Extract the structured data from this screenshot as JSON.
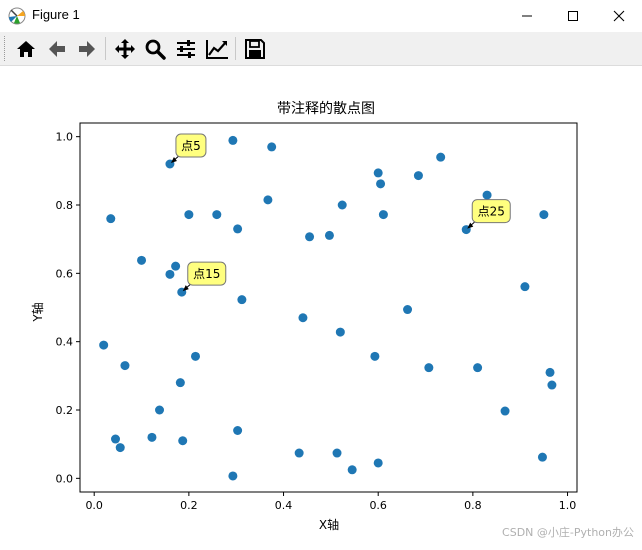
{
  "window": {
    "title": "Figure 1",
    "icons": {
      "app": "matplotlib-icon",
      "minimize": "minimize-icon",
      "maximize": "maximize-icon",
      "close": "close-icon"
    }
  },
  "toolbar": {
    "buttons": [
      {
        "name": "home",
        "icon": "home-icon"
      },
      {
        "name": "back",
        "icon": "back-arrow-icon"
      },
      {
        "name": "forward",
        "icon": "forward-arrow-icon"
      },
      {
        "name": "pan",
        "icon": "pan-move-icon"
      },
      {
        "name": "zoom",
        "icon": "zoom-magnifier-icon"
      },
      {
        "name": "subplots",
        "icon": "configure-subplots-icon"
      },
      {
        "name": "edit-axis",
        "icon": "edit-axis-curve-icon"
      },
      {
        "name": "save",
        "icon": "save-floppy-icon"
      }
    ]
  },
  "watermark": "CSDN @小庄-Python办公",
  "chart_data": {
    "type": "scatter",
    "title": "带注释的散点图",
    "xlabel": "X轴",
    "ylabel": "Y轴",
    "xlim": [
      -0.03,
      1.02
    ],
    "ylim": [
      -0.04,
      1.04
    ],
    "xticks": [
      "0.0",
      "0.2",
      "0.4",
      "0.6",
      "0.8",
      "1.0"
    ],
    "yticks": [
      "0.0",
      "0.2",
      "0.4",
      "0.6",
      "0.8",
      "1.0"
    ],
    "marker_color": "#1f77b4",
    "annotation_color": "#ffff7f",
    "points": [
      [
        0.02,
        0.39
      ],
      [
        0.035,
        0.76
      ],
      [
        0.045,
        0.115
      ],
      [
        0.055,
        0.09
      ],
      [
        0.065,
        0.33
      ],
      [
        0.1,
        0.638
      ],
      [
        0.122,
        0.12
      ],
      [
        0.138,
        0.2
      ],
      [
        0.16,
        0.597
      ],
      [
        0.16,
        0.92
      ],
      [
        0.172,
        0.621
      ],
      [
        0.182,
        0.28
      ],
      [
        0.185,
        0.545
      ],
      [
        0.187,
        0.11
      ],
      [
        0.2,
        0.772
      ],
      [
        0.214,
        0.357
      ],
      [
        0.259,
        0.772
      ],
      [
        0.293,
        0.989
      ],
      [
        0.293,
        0.007
      ],
      [
        0.303,
        0.73
      ],
      [
        0.303,
        0.14
      ],
      [
        0.312,
        0.523
      ],
      [
        0.367,
        0.815
      ],
      [
        0.375,
        0.97
      ],
      [
        0.433,
        0.074
      ],
      [
        0.441,
        0.47
      ],
      [
        0.455,
        0.707
      ],
      [
        0.497,
        0.711
      ],
      [
        0.513,
        0.074
      ],
      [
        0.52,
        0.428
      ],
      [
        0.524,
        0.8
      ],
      [
        0.545,
        0.025
      ],
      [
        0.593,
        0.357
      ],
      [
        0.6,
        0.894
      ],
      [
        0.6,
        0.045
      ],
      [
        0.605,
        0.862
      ],
      [
        0.611,
        0.772
      ],
      [
        0.662,
        0.494
      ],
      [
        0.685,
        0.886
      ],
      [
        0.707,
        0.324
      ],
      [
        0.732,
        0.94
      ],
      [
        0.786,
        0.728
      ],
      [
        0.81,
        0.324
      ],
      [
        0.83,
        0.829
      ],
      [
        0.868,
        0.197
      ],
      [
        0.91,
        0.561
      ],
      [
        0.947,
        0.062
      ],
      [
        0.95,
        0.772
      ],
      [
        0.963,
        0.31
      ],
      [
        0.967,
        0.273
      ]
    ],
    "annotations": [
      {
        "text": "点5",
        "x": 0.16,
        "y": 0.92
      },
      {
        "text": "点15",
        "x": 0.185,
        "y": 0.545
      },
      {
        "text": "点25",
        "x": 0.786,
        "y": 0.728
      }
    ]
  }
}
